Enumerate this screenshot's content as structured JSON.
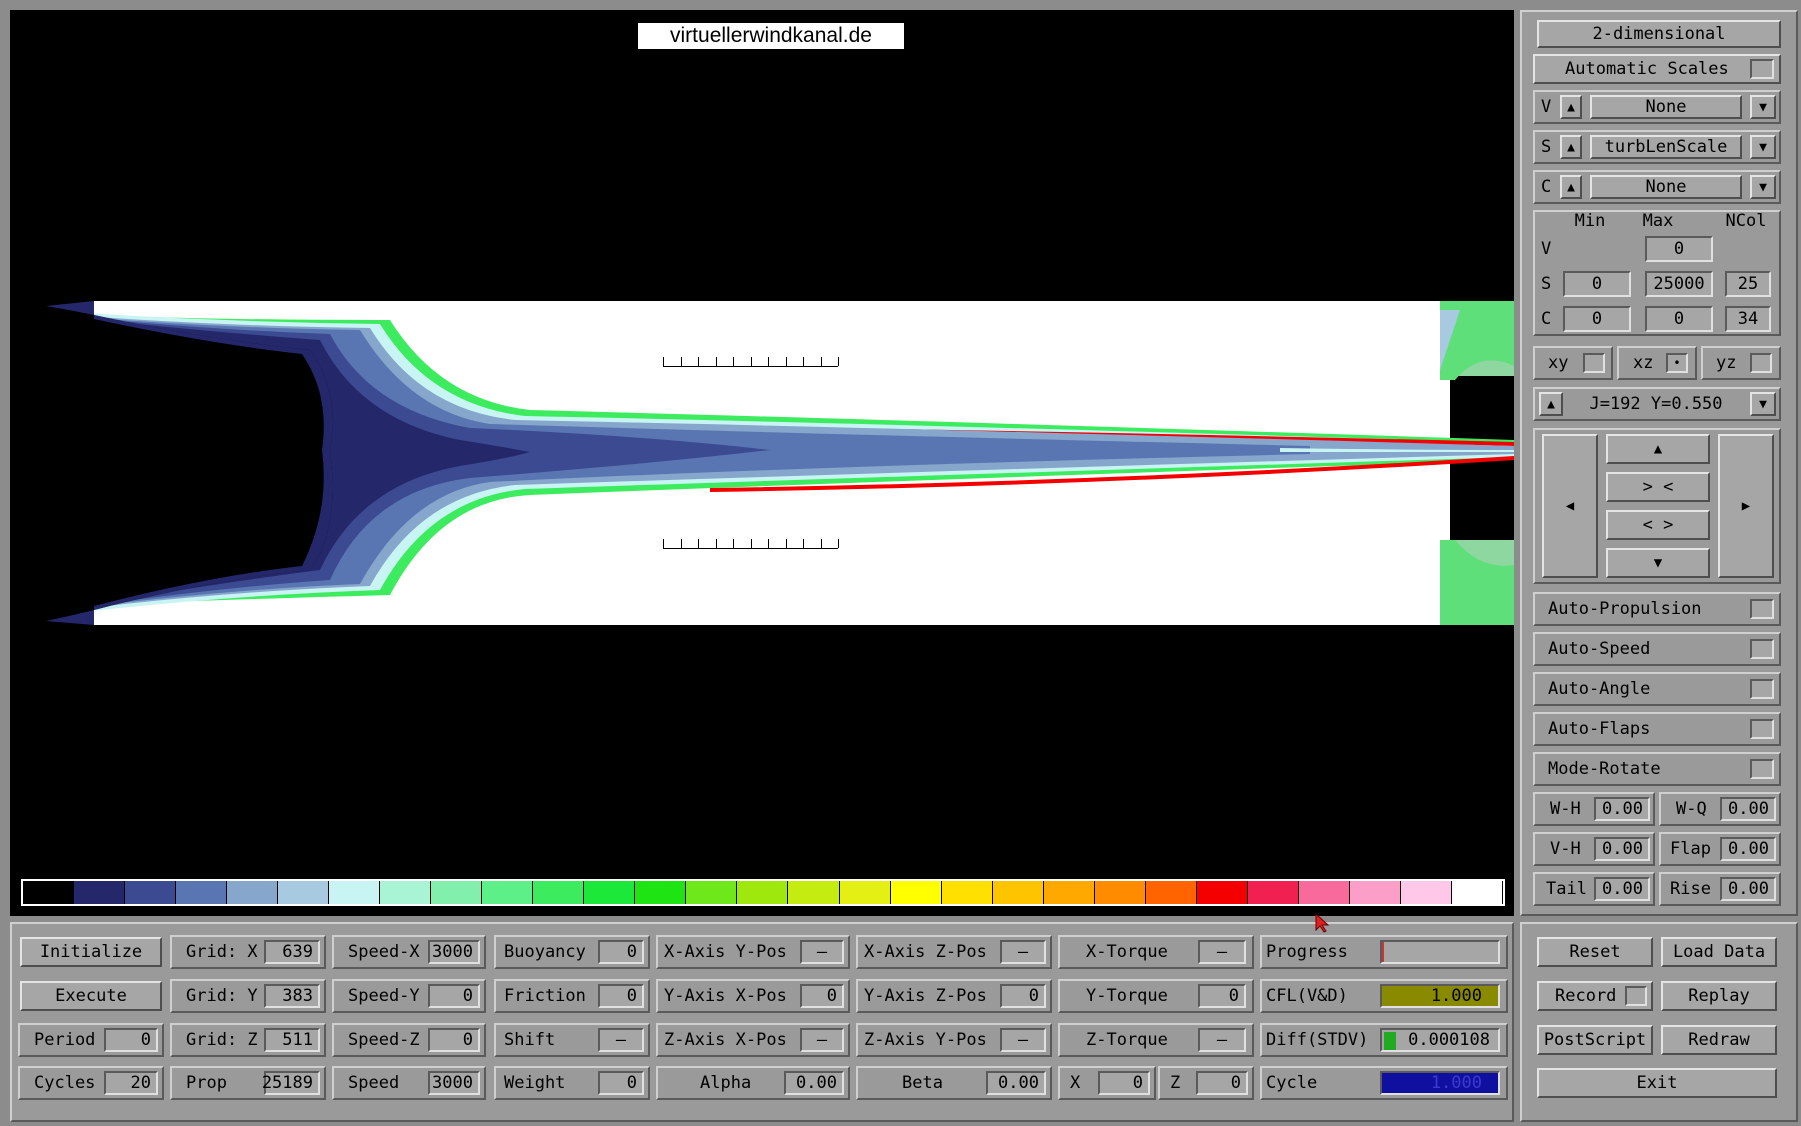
{
  "viewport": {
    "site_label": "virtuellerwindkanal.de",
    "colorbar_colors": [
      "#000000",
      "#24286a",
      "#3c4a92",
      "#5a76b2",
      "#86a6cc",
      "#a8cae0",
      "#c8f4f4",
      "#a8f4d4",
      "#82f0ac",
      "#5ef088",
      "#3cec5e",
      "#1ce83a",
      "#1ee414",
      "#6ee81a",
      "#9ee80e",
      "#c4ec10",
      "#e4f014",
      "#ffff00",
      "#ffe000",
      "#ffc400",
      "#ffa800",
      "#ff8c00",
      "#ff6400",
      "#f40000",
      "#f02050",
      "#f86a9c",
      "#fb9ec8",
      "#ffc8e8",
      "#ffffff"
    ]
  },
  "sidebar": {
    "mode_button": "2-dimensional",
    "auto_scales": "Automatic Scales",
    "selectors": [
      {
        "letter": "V",
        "value": "None"
      },
      {
        "letter": "S",
        "value": "turbLenScale"
      },
      {
        "letter": "C",
        "value": "None"
      }
    ],
    "scale_headers": {
      "min": "Min",
      "max": "Max",
      "ncol": "NCol"
    },
    "scale_rows": [
      {
        "letter": "V",
        "min": "",
        "max": "0",
        "ncol": ""
      },
      {
        "letter": "S",
        "min": "0",
        "max": "25000",
        "ncol": "25"
      },
      {
        "letter": "C",
        "min": "0",
        "max": "0",
        "ncol": "34"
      }
    ],
    "planes": [
      {
        "label": "xy",
        "selected": false
      },
      {
        "label": "xz",
        "selected": true
      },
      {
        "label": "yz",
        "selected": false
      }
    ],
    "slice_label": "J=192  Y=0.550",
    "nav": {
      "up": "▲",
      "down": "▼",
      "left": "◀",
      "right": "▶",
      "zoom_in": "> <",
      "zoom_out": "< >"
    },
    "toggles": [
      "Auto-Propulsion",
      "Auto-Speed",
      "Auto-Angle",
      "Auto-Flaps",
      "Mode-Rotate"
    ],
    "params": [
      {
        "label": "W-H",
        "value": "0.00"
      },
      {
        "label": "W-Q",
        "value": "0.00"
      },
      {
        "label": "V-H",
        "value": "0.00"
      },
      {
        "label": "Flap",
        "value": "0.00"
      },
      {
        "label": "Tail",
        "value": "0.00"
      },
      {
        "label": "Rise",
        "value": "0.00"
      }
    ],
    "actions": {
      "reset": "Reset",
      "load_data": "Load Data",
      "record": "Record",
      "replay": "Replay",
      "postscript": "PostScript",
      "redraw": "Redraw",
      "exit": "Exit"
    }
  },
  "bottom": {
    "initialize": "Initialize",
    "execute": "Execute",
    "period_label": "Period",
    "period": "0",
    "cycles_label": "Cycles",
    "cycles": "20",
    "grid_x_label": "Grid: X",
    "grid_x": "639",
    "grid_y_label": "Grid: Y",
    "grid_y": "383",
    "grid_z_label": "Grid: Z",
    "grid_z": "511",
    "prop_label": "Prop",
    "prop": "25189",
    "speed_x_label": "Speed-X",
    "speed_x": "3000",
    "speed_y_label": "Speed-Y",
    "speed_y": "0",
    "speed_z_label": "Speed-Z",
    "speed_z": "0",
    "speed_label": "Speed",
    "speed": "3000",
    "buoyancy_label": "Buoyancy",
    "buoyancy": "0",
    "friction_label": "Friction",
    "friction": "0",
    "shift_label": "Shift",
    "shift": "—",
    "weight_label": "Weight",
    "weight": "0",
    "x_axis_y_pos_label": "X-Axis Y-Pos",
    "x_axis_y_pos": "—",
    "y_axis_x_pos_label": "Y-Axis X-Pos",
    "y_axis_x_pos": "0",
    "z_axis_x_pos_label": "Z-Axis X-Pos",
    "z_axis_x_pos": "—",
    "alpha_label": "Alpha",
    "alpha": "0.00",
    "x_axis_z_pos_label": "X-Axis Z-Pos",
    "x_axis_z_pos": "—",
    "y_axis_z_pos_label": "Y-Axis Z-Pos",
    "y_axis_z_pos": "0",
    "z_axis_y_pos_label": "Z-Axis Y-Pos",
    "z_axis_y_pos": "—",
    "beta_label": "Beta",
    "beta": "0.00",
    "x_torque_label": "X-Torque",
    "x_torque": "—",
    "y_torque_label": "Y-Torque",
    "y_torque": "0",
    "z_torque_label": "Z-Torque",
    "z_torque": "—",
    "x_label": "X",
    "x": "0",
    "z_label": "Z",
    "z": "0",
    "progress_label": "Progress",
    "progress_fraction": 0.0,
    "cfl_label": "CFL(V&D)",
    "cfl": "1.000",
    "cfl_color": "#8a8a00",
    "diff_label": "Diff(STDV)",
    "diff": "0.000108",
    "diff_color": "#22aa22",
    "cycle_label": "Cycle",
    "cycle": "1.000",
    "cycle_color": "#1010a0"
  }
}
